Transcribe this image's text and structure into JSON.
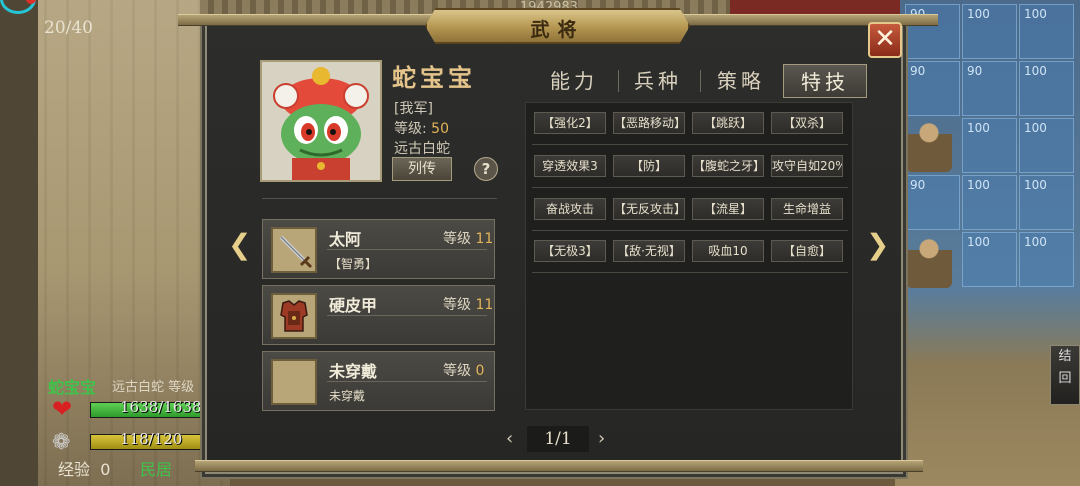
{
  "hud": {
    "turn_counter": "20/40",
    "top_score": "1942983"
  },
  "map_grid_numbers": [
    "90",
    "100"
  ],
  "status": {
    "name": "蛇宝宝",
    "sub": "远古白蛇  等级",
    "hp_text": "1638/1638",
    "hp_fraction": 1.0,
    "mp_text": "118/120",
    "mp_fraction": 0.98,
    "exp_label": "经验",
    "exp_value": "0",
    "civ": "民居"
  },
  "dialog": {
    "title": "武将",
    "close_icon": "close-x-icon"
  },
  "hero": {
    "name": "蛇宝宝",
    "faction": "[我军]",
    "level_label": "等级:",
    "level_value": "50",
    "class": "远古白蛇",
    "bio_button": "列传",
    "help_button": "?"
  },
  "equipment": [
    {
      "name": "太阿",
      "level_label": "等级",
      "level": "11",
      "desc": "【智勇】",
      "icon": "sword-icon"
    },
    {
      "name": "硬皮甲",
      "level_label": "等级",
      "level": "11",
      "desc": "",
      "icon": "armor-icon"
    },
    {
      "name": "未穿戴",
      "level_label": "等级",
      "level": "0",
      "desc": "未穿戴",
      "icon": "empty-slot-icon"
    }
  ],
  "tabs": [
    {
      "label": "能力",
      "active": false
    },
    {
      "label": "兵种",
      "active": false
    },
    {
      "label": "策略",
      "active": false
    },
    {
      "label": "特技",
      "active": true
    }
  ],
  "skills": [
    [
      "【强化2】",
      "【恶路移动】",
      "【跳跃】",
      "【双杀】"
    ],
    [
      "穿透效果3",
      "【防】",
      "【腹蛇之牙】",
      "攻守自如20%"
    ],
    [
      "奋战攻击",
      "【无反攻击】",
      "【流星】",
      "生命增益"
    ],
    [
      "【无极3】",
      "【敌·无视】",
      "吸血10",
      "【自愈】"
    ]
  ],
  "pager": {
    "text": "1/1",
    "prev": "‹",
    "next": "›"
  },
  "side_button": "结\n回",
  "colors": {
    "accent_gold": "#e2b45a",
    "hp_green": "#3ec24a",
    "close_red": "#c65a3c"
  }
}
